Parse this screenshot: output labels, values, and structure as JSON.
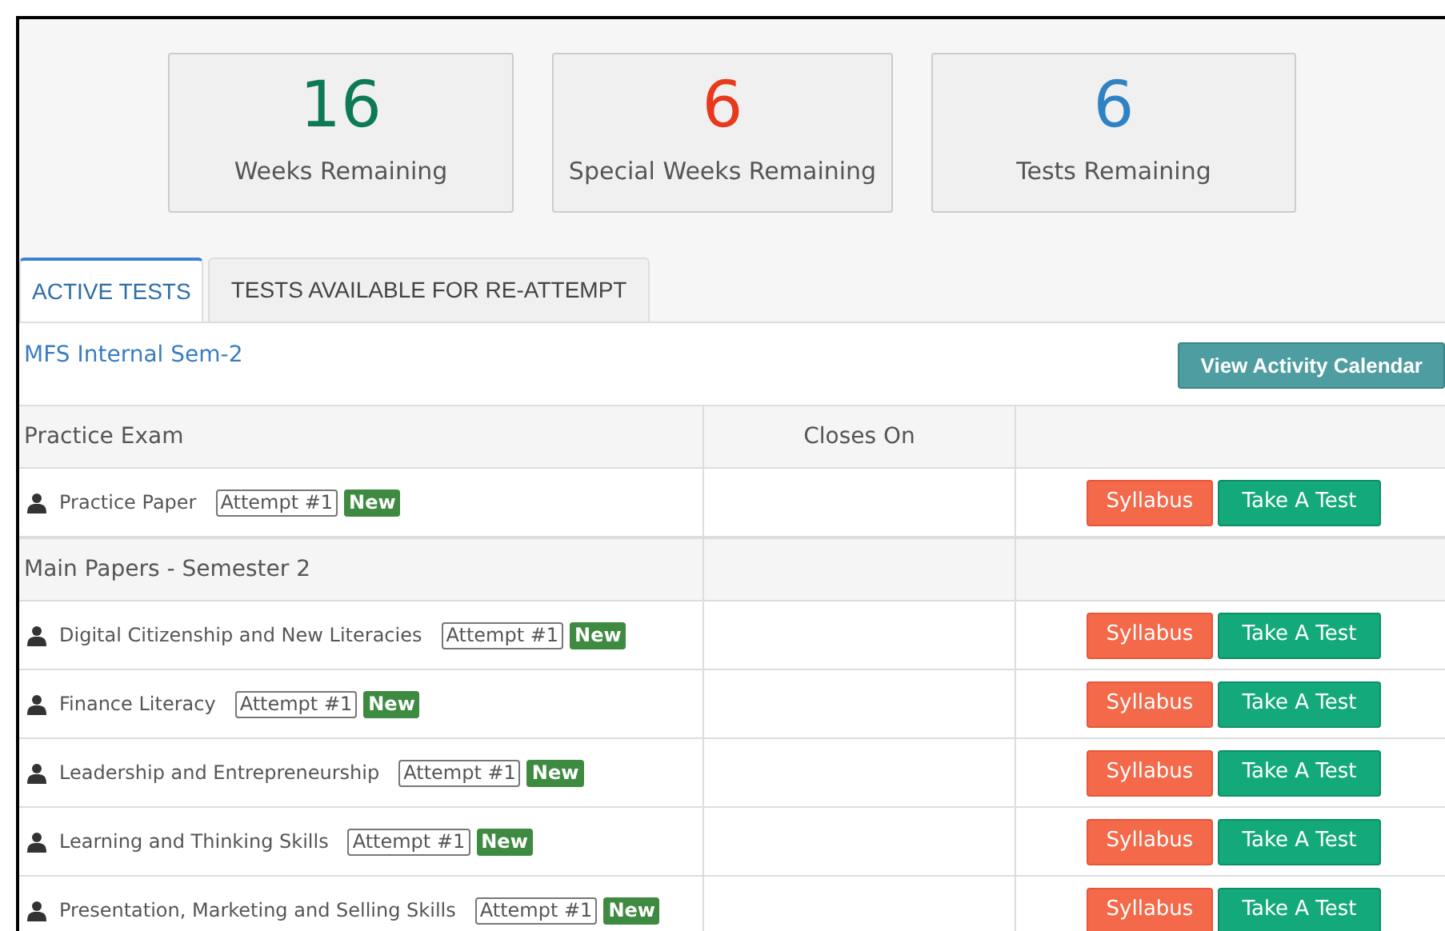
{
  "stats": [
    {
      "value": "16",
      "label": "Weeks Remaining",
      "color": "#0d7a57"
    },
    {
      "value": "6",
      "label": "Special Weeks Remaining",
      "color": "#e8391c"
    },
    {
      "value": "6",
      "label": "Tests Remaining",
      "color": "#2f83c5"
    }
  ],
  "tabs": [
    {
      "label": "ACTIVE TESTS",
      "selected": true
    },
    {
      "label": "TESTS AVAILABLE FOR RE-ATTEMPT",
      "selected": false
    }
  ],
  "course": "MFS Internal Sem-2",
  "calendar_button": "View Activity Calendar",
  "groups": [
    {
      "title": "Practice Exam",
      "column_2": "Closes On",
      "tests": [
        {
          "name": "Practice Paper",
          "attempt": "Attempt #1",
          "badge": "New",
          "syllabus": "Syllabus",
          "take": "Take A Test"
        }
      ]
    },
    {
      "title": "Main Papers - Semester 2",
      "tests": [
        {
          "name": "Digital Citizenship and New Literacies",
          "attempt": "Attempt #1",
          "badge": "New",
          "syllabus": "Syllabus",
          "take": "Take A Test"
        },
        {
          "name": "Finance Literacy",
          "attempt": "Attempt #1",
          "badge": "New",
          "syllabus": "Syllabus",
          "take": "Take A Test"
        },
        {
          "name": "Leadership and Entrepreneurship",
          "attempt": "Attempt #1",
          "badge": "New",
          "syllabus": "Syllabus",
          "take": "Take A Test"
        },
        {
          "name": "Learning and Thinking Skills",
          "attempt": "Attempt #1",
          "badge": "New",
          "syllabus": "Syllabus",
          "take": "Take A Test"
        },
        {
          "name": "Presentation, Marketing and Selling Skills",
          "attempt": "Attempt #1",
          "badge": "New",
          "syllabus": "Syllabus",
          "take": "Take A Test"
        }
      ]
    }
  ]
}
